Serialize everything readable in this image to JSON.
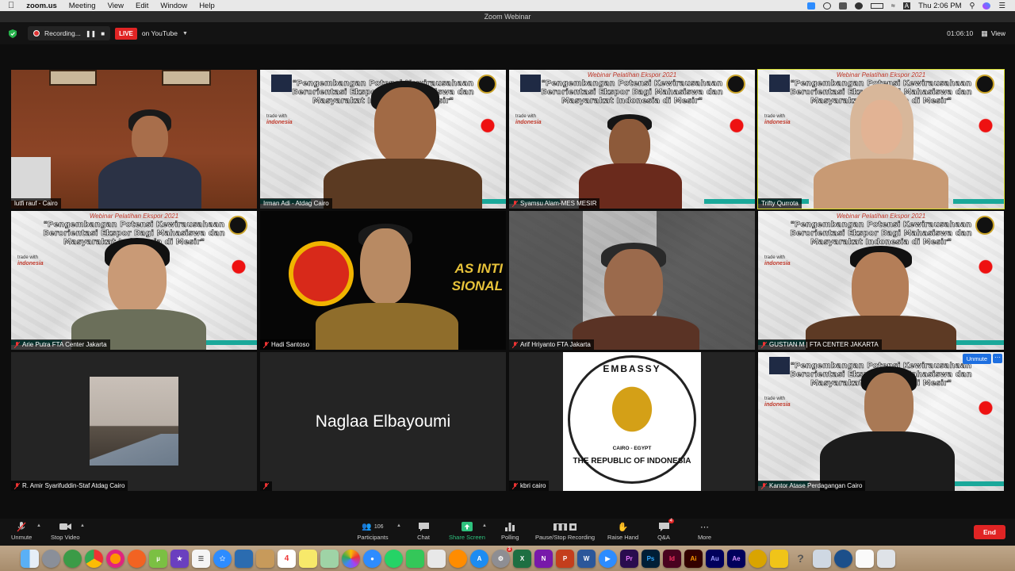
{
  "menubar": {
    "app": "zoom.us",
    "menus": [
      "Meeting",
      "View",
      "Edit",
      "Window",
      "Help"
    ],
    "clock": "Thu 2:06 PM",
    "input_letter": "A"
  },
  "window": {
    "title": "Zoom Webinar"
  },
  "topbar": {
    "recording_label": "Recording...",
    "live_label": "LIVE",
    "stream_label": "on YouTube",
    "timer": "01:06:10",
    "view_label": "View"
  },
  "slide": {
    "subtitle": "Webinar Pelatihan Ekspor 2021",
    "title": "\"Pengembangan Potensi Kewirausahaan Berorientasi Ekspor Bagi Mahasiswa dan Masyarakat Indonesia di Mesir\"",
    "trade_with": "trade with",
    "indonesia": "indonesia",
    "atase": "Atase Perdagangan Cairo"
  },
  "tiles": [
    {
      "name": "lutfi rauf - Cairo",
      "muted": false
    },
    {
      "name": "Irman Adi - Atdag Cairo",
      "muted": false
    },
    {
      "name": "Syamsu Alam-MES MESIR",
      "muted": true
    },
    {
      "name": "Trifty Qurrota",
      "muted": false,
      "speaking": true
    },
    {
      "name": "Arie Putra FTA Center Jakarta",
      "muted": true
    },
    {
      "name": "Hadi Santoso",
      "muted": true,
      "bg_text": "AS INTI SIONAL"
    },
    {
      "name": "Arif Hriyanto FTA Jakarta",
      "muted": true
    },
    {
      "name": "GUSTIAN M | FTA CENTER JAKARTA",
      "muted": true
    },
    {
      "name": "R. Amir Syarifuddin-Staf Atdag Cairo",
      "muted": true
    },
    {
      "name": "",
      "muted": true,
      "display_name": "Naglaa Elbayoumi"
    },
    {
      "name": "kbri cairo",
      "muted": true,
      "emblem_top": "EMBASSY",
      "emblem_mid": "CAIRO - EGYPT",
      "emblem_bottom": "THE REPUBLIC OF INDONESIA"
    },
    {
      "name": "Kantor Atase Perdagangan Cairo",
      "muted": true,
      "unmute_label": "Unmute"
    }
  ],
  "toolbar": {
    "unmute": "Unmute",
    "stop_video": "Stop Video",
    "participants": "Participants",
    "participants_count": "106",
    "chat": "Chat",
    "share_screen": "Share Screen",
    "polling": "Polling",
    "pause_stop_recording": "Pause/Stop Recording",
    "raise_hand": "Raise Hand",
    "qa": "Q&A",
    "qa_badge": "4",
    "more": "More",
    "end": "End"
  },
  "dock": {
    "calendar_day": "4",
    "badge": "3",
    "apps": [
      "Finder",
      "Launchpad",
      "Safari",
      "Chrome",
      "Firefox",
      "Brave",
      "uTorrent",
      "iMovie",
      "Notes",
      "Maps",
      "Photos",
      "Messages",
      "WhatsApp",
      "Facetime",
      "App Store",
      "Settings",
      "Excel",
      "OneNote",
      "PowerPoint",
      "Word",
      "Zoom",
      "Premiere",
      "Photoshop",
      "InDesign",
      "Illustrator",
      "Audition",
      "After Effects",
      "Lightroom",
      "Spreadsheet",
      "Help",
      "Preview",
      "QuickTime",
      "Notepad",
      "Trash"
    ]
  },
  "colors": {
    "live": "#e02424",
    "speaking": "#d9e02a",
    "share": "#2ec27e",
    "end": "#e02424"
  }
}
